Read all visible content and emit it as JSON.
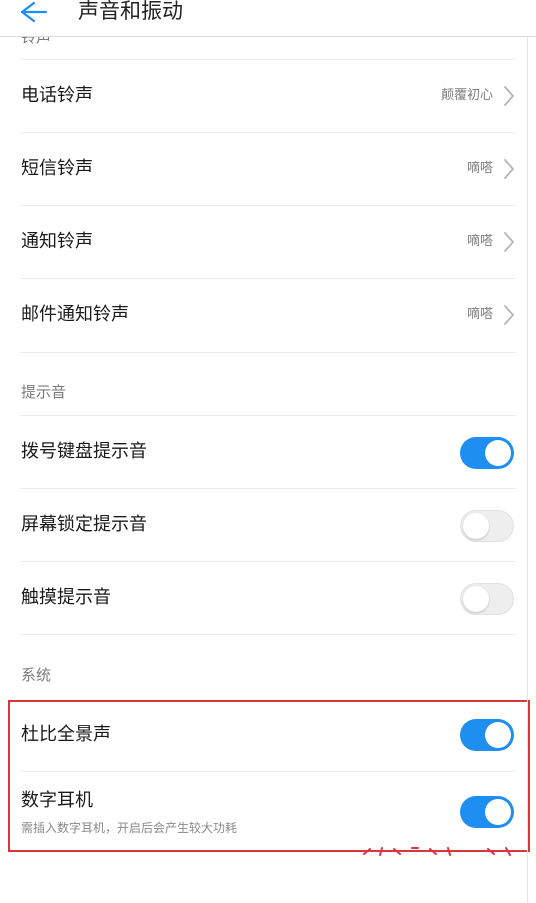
{
  "header": {
    "title": "声音和振动",
    "back_icon": "back-arrow-icon"
  },
  "sections": {
    "ringtones": {
      "header": "铃声",
      "items": [
        {
          "label": "电话铃声",
          "value": "颠覆初心"
        },
        {
          "label": "短信铃声",
          "value": "嘀嗒"
        },
        {
          "label": "通知铃声",
          "value": "嘀嗒"
        },
        {
          "label": "邮件通知铃声",
          "value": "嘀嗒"
        }
      ]
    },
    "tones": {
      "header": "提示音",
      "items": [
        {
          "label": "拨号键盘提示音",
          "state": "on"
        },
        {
          "label": "屏幕锁定提示音",
          "state": "off"
        },
        {
          "label": "触摸提示音",
          "state": "off"
        }
      ]
    },
    "system": {
      "header": "系统",
      "items": [
        {
          "label": "杜比全景声",
          "state": "on"
        },
        {
          "label": "数字耳机",
          "sublabel": "需插入数字耳机，开启后会产生较大功耗",
          "state": "on"
        }
      ]
    }
  },
  "colors": {
    "accent": "#1f8ef1",
    "toggle_off": "#eeeeee",
    "highlight": "#d9363e",
    "header_icon": "#1f8ef1"
  }
}
